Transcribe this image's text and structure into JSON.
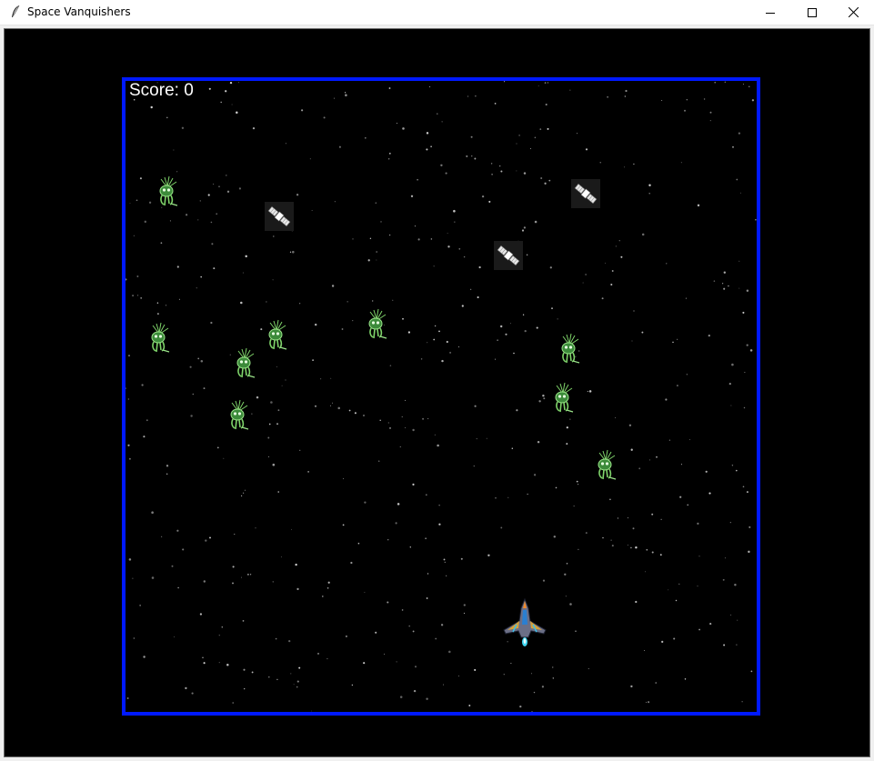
{
  "window": {
    "title": "Space Vanquishers",
    "controls": [
      "minimize",
      "maximize",
      "close"
    ]
  },
  "game": {
    "score_label": "Score: 0",
    "border_color": "#0019ff",
    "aliens": [
      {
        "name": "green-alien"
      },
      {
        "name": "green-alien"
      },
      {
        "name": "green-alien"
      },
      {
        "name": "green-alien"
      },
      {
        "name": "green-alien"
      },
      {
        "name": "green-alien"
      },
      {
        "name": "green-alien"
      },
      {
        "name": "green-alien"
      },
      {
        "name": "green-alien"
      }
    ],
    "satellites": [
      {
        "name": "satellite"
      },
      {
        "name": "satellite"
      },
      {
        "name": "satellite"
      }
    ],
    "player": {
      "name": "player-spaceship"
    }
  }
}
